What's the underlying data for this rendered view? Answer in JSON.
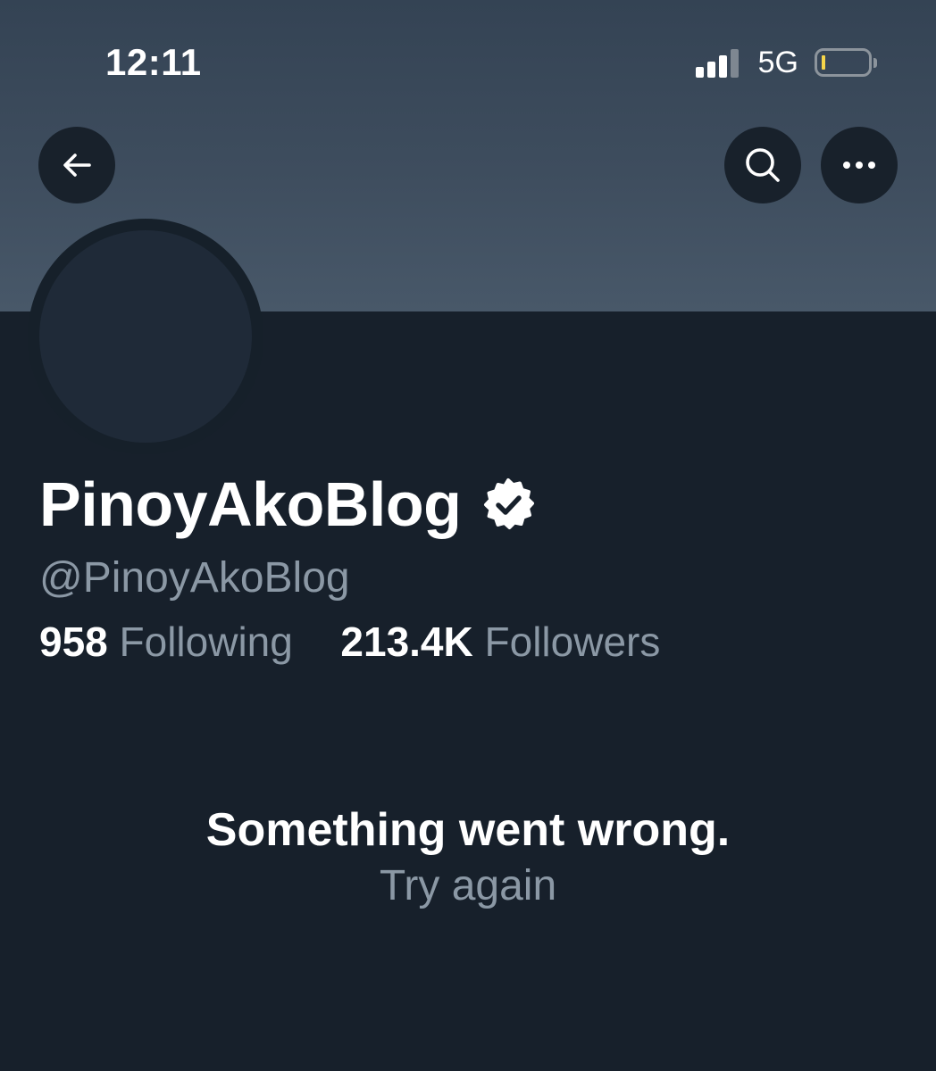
{
  "status_bar": {
    "time": "12:11",
    "network": "5G",
    "icons": [
      "cellular-signal-icon",
      "battery-icon"
    ],
    "battery_color": "#f5d54a"
  },
  "header": {
    "back_icon": "arrow-left-icon",
    "search_icon": "search-icon",
    "more_icon": "more-horizontal-icon"
  },
  "profile": {
    "display_name": "PinoyAkoBlog",
    "verified_icon": "verified-badge-icon",
    "handle": "@PinoyAkoBlog",
    "following_count": "958",
    "following_label": "Following",
    "followers_count": "213.4K",
    "followers_label": "Followers"
  },
  "error": {
    "message": "Something went wrong.",
    "retry_label": "Try again"
  },
  "colors": {
    "background": "#17202b",
    "banner": "#3e4d5e",
    "secondary_text": "#8b98a5",
    "primary_text": "#ffffff"
  }
}
